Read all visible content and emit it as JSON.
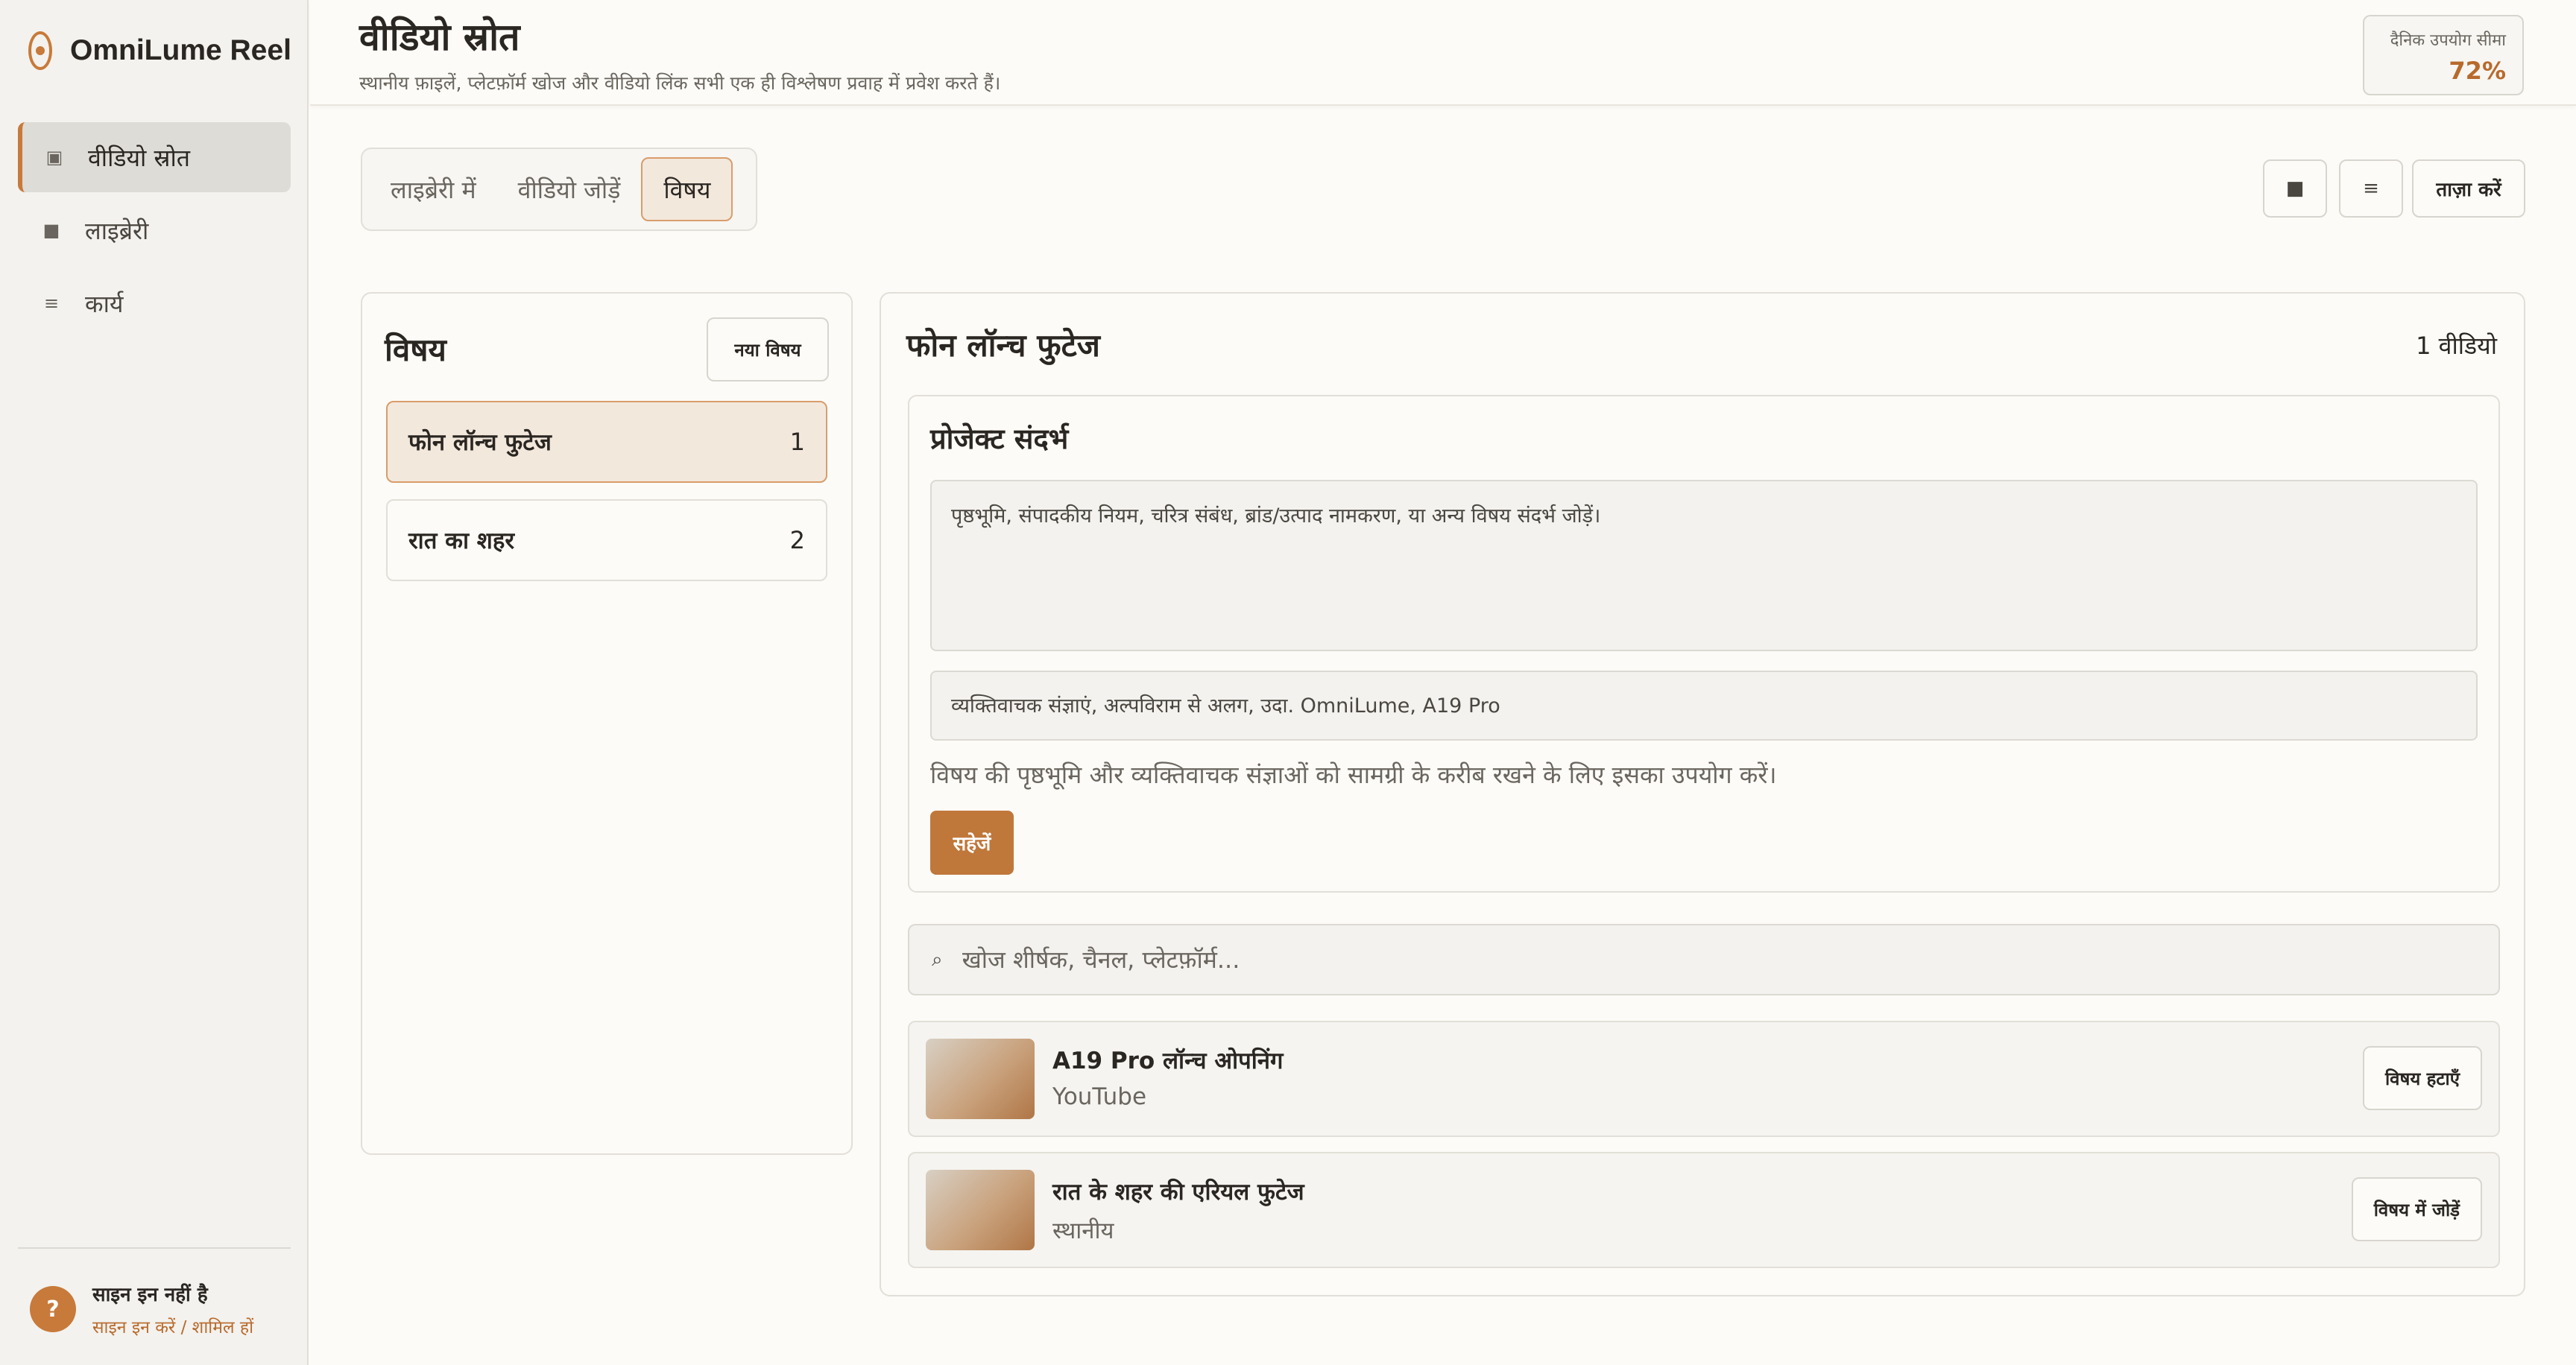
{
  "app": {
    "name": "OmniLume Reel"
  },
  "sidebar": {
    "items": [
      {
        "label": "वीडियो स्रोत",
        "icon": "▣",
        "active": true
      },
      {
        "label": "लाइब्रेरी",
        "icon": "■",
        "active": false
      },
      {
        "label": "कार्य",
        "icon": "≡",
        "active": false
      }
    ],
    "user": {
      "help_icon": "?",
      "status": "साइन इन नहीं है",
      "link": "साइन इन करें / शामिल हों"
    }
  },
  "header": {
    "title": "वीडियो स्रोत",
    "subtitle": "स्थानीय फ़ाइलें, प्लेटफ़ॉर्म खोज और वीडियो लिंक सभी एक ही विश्लेषण प्रवाह में प्रवेश करते हैं।",
    "quota_label": "दैनिक उपयोग सीमा",
    "quota_value": "72%"
  },
  "tabs": [
    {
      "label": "लाइब्रेरी में"
    },
    {
      "label": "वीडियो जोड़ें"
    },
    {
      "label": "विषय",
      "active": true
    }
  ],
  "toolbar": {
    "stop_icon": "■",
    "menu_icon": "≡",
    "refresh_label": "ताज़ा करें"
  },
  "topics": {
    "title": "विषय",
    "new_label": "नया विषय",
    "items": [
      {
        "name": "फोन लॉन्च फुटेज",
        "count": "1"
      },
      {
        "name": "रात का शहर",
        "count": "2"
      }
    ]
  },
  "detail": {
    "title": "फोन लॉन्च फुटेज",
    "count": "1 वीडियो",
    "context": {
      "title": "प्रोजेक्ट संदर्भ",
      "textarea_placeholder": "पृष्ठभूमि, संपादकीय नियम, चरित्र संबंध, ब्रांड/उत्पाद नामकरण, या अन्य विषय संदर्भ जोड़ें।",
      "input_placeholder": "व्यक्तिवाचक संज्ञाएं, अल्पविराम से अलग, उदा. OmniLume, A19 Pro",
      "hint": "विषय की पृष्ठभूमि और व्यक्तिवाचक संज्ञाओं को सामग्री के करीब रखने के लिए इसका उपयोग करें।",
      "save_label": "सहेजें"
    },
    "search": {
      "icon": "⌕",
      "placeholder": "खोज शीर्षक, चैनल, प्लेटफ़ॉर्म..."
    },
    "videos": [
      {
        "title": "A19 Pro लॉन्च ओपनिंग",
        "source": "YouTube",
        "action": "विषय हटाएँ"
      },
      {
        "title": "रात के शहर की एरियल फुटेज",
        "source": "स्थानीय",
        "action": "विषय में जोड़ें"
      }
    ]
  }
}
